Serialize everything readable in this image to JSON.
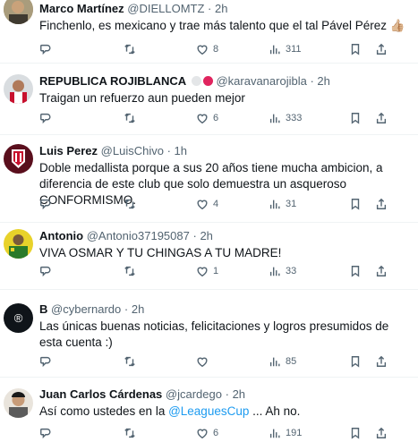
{
  "tweets": [
    {
      "name": "Marco Martínez",
      "handle": "@DIELLOMTZ",
      "dot": "·",
      "time": "2h",
      "text": "Finchenlo, es mexicano y trae más talento que el tal Pável Pérez 👍🏼",
      "reply_count": "",
      "retweet_count": "",
      "like_count": "8",
      "view_count": "311"
    },
    {
      "name": "REPUBLICA ROJIBLANCA",
      "handle": "@karavanarojibla",
      "dot": "·",
      "time": "2h",
      "text": "Traigan un refuerzo aun pueden mejor",
      "reply_count": "",
      "retweet_count": "",
      "like_count": "6",
      "view_count": "333"
    },
    {
      "name": "Luis Perez",
      "handle": "@LuisChivo",
      "dot": "·",
      "time": "1h",
      "text": "Doble medallista porque a sus 20 años tiene mucha ambicion, a diferencia de este club que solo demuestra un asqueroso CONFORMISMO.",
      "reply_count": "",
      "retweet_count": "",
      "like_count": "4",
      "view_count": "31"
    },
    {
      "name": "Antonio",
      "handle": "@Antonio37195087",
      "dot": "·",
      "time": "2h",
      "text": "VIVA OSMAR Y TU CHINGAS A TU MADRE!",
      "reply_count": "",
      "retweet_count": "",
      "like_count": "1",
      "view_count": "33"
    },
    {
      "name": "B",
      "handle": "@cybernardo",
      "dot": "·",
      "time": "2h",
      "text": "Las únicas buenas noticias, felicitaciones y logros presumidos de esta cuenta :)",
      "reply_count": "",
      "retweet_count": "",
      "like_count": "",
      "view_count": "85"
    },
    {
      "name": "Juan Carlos Cárdenas",
      "handle": "@jcardego",
      "dot": "·",
      "time": "2h",
      "text_before": "Así como ustedes en la ",
      "text_mention": "@LeaguesCup",
      "text_after": " ... Ah no.",
      "reply_count": "",
      "retweet_count": "",
      "like_count": "6",
      "view_count": "191"
    }
  ],
  "colors": {
    "text": "#0f1419",
    "muted": "#536471",
    "link": "#1d9bf0",
    "divider": "#eff3f4"
  }
}
